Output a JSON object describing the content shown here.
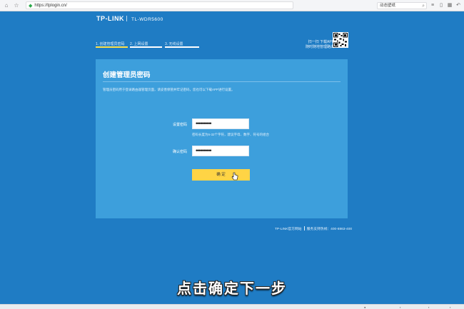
{
  "browser": {
    "url": "https://tplogin.cn/",
    "search_text": "动态壁纸"
  },
  "router": {
    "brand": "TP-LINK",
    "model": "TL-WDR5600",
    "steps": [
      {
        "label": "1. 创建管理员密码",
        "active": true
      },
      {
        "label": "2. 上网设置",
        "active": false
      },
      {
        "label": "3. 无线设置",
        "active": false
      }
    ],
    "app_text_line1": "扫一扫 下载APP",
    "app_text_line2": "随时随地管理路由",
    "card": {
      "title": "创建管理员密码",
      "description": "管理员密码用于登录路由器管理页面，请妥善保管并牢记密码，您也可以下载APP进行设置。",
      "password_label": "设置密码",
      "password_value": "••••••••••",
      "hint": "密码长度为6-32个字符，建议字母、数字、符号的组合",
      "confirm_label": "确认密码",
      "confirm_value": "••••••••••",
      "submit_label": "确 定"
    },
    "footer": {
      "site": "TP-LINK官方网站",
      "support": "服务支持热线：400-8863-400"
    }
  },
  "subtitle": "点击确定下一步",
  "accent_color": "#1f7cc4",
  "button_color": "#ffd445",
  "active_step_color": "#ffe14a"
}
